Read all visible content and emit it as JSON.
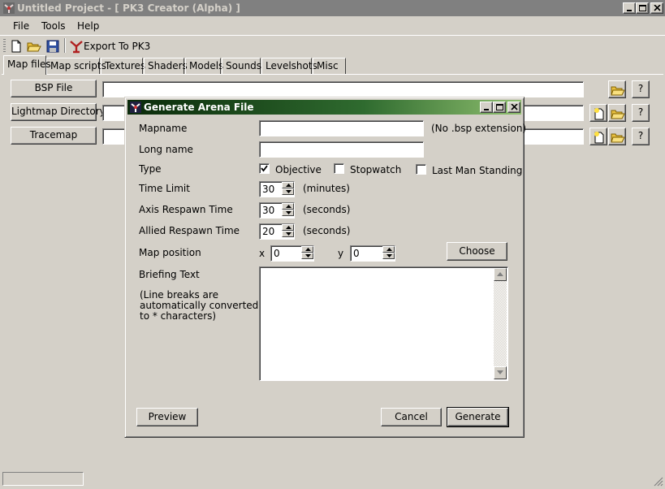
{
  "window": {
    "title": "Untitled Project - [ PK3 Creator (Alpha) ]"
  },
  "menu": [
    "File",
    "Tools",
    "Help"
  ],
  "toolbar": {
    "icons": [
      "new-file-icon",
      "open-folder-icon",
      "save-disk-icon",
      "export-icon"
    ],
    "export_label": "Export To PK3"
  },
  "tabs": [
    "Map files",
    "Map scripts",
    "Textures",
    "Shaders",
    "Models",
    "Sounds",
    "Levelshots",
    "Misc"
  ],
  "active_tab": "Map files",
  "map_files": {
    "bsp_button": "BSP File",
    "lightmap_button": "Lightmap Directory",
    "tracemap_button": "Tracemap",
    "help_label": "?"
  },
  "dialog": {
    "title": "Generate Arena File",
    "labels": {
      "mapname": "Mapname",
      "long_name": "Long name",
      "type": "Type",
      "time_limit": "Time Limit",
      "axis_respawn": "Axis Respawn Time",
      "allied_respawn": "Allied Respawn Time",
      "map_position": "Map position",
      "briefing": "Briefing Text",
      "briefing_note": [
        "(Line breaks are",
        "automatically converted",
        "to * characters)"
      ]
    },
    "hints": {
      "mapname": "(No .bsp extension)",
      "minutes": "(minutes)",
      "seconds_axis": "(seconds)",
      "seconds_allied": "(seconds)"
    },
    "fields": {
      "mapname": "",
      "long_name": "",
      "time_limit": "30",
      "axis_respawn": "30",
      "allied_respawn": "20",
      "pos_x_label": "x",
      "pos_x": "0",
      "pos_y_label": "y",
      "pos_y": "0",
      "briefing": ""
    },
    "types": [
      {
        "label": "Objective",
        "checked": true
      },
      {
        "label": "Stopwatch",
        "checked": false
      },
      {
        "label": "Last Man Standing",
        "checked": false
      }
    ],
    "buttons": {
      "choose": "Choose",
      "preview": "Preview",
      "cancel": "Cancel",
      "generate": "Generate"
    }
  }
}
